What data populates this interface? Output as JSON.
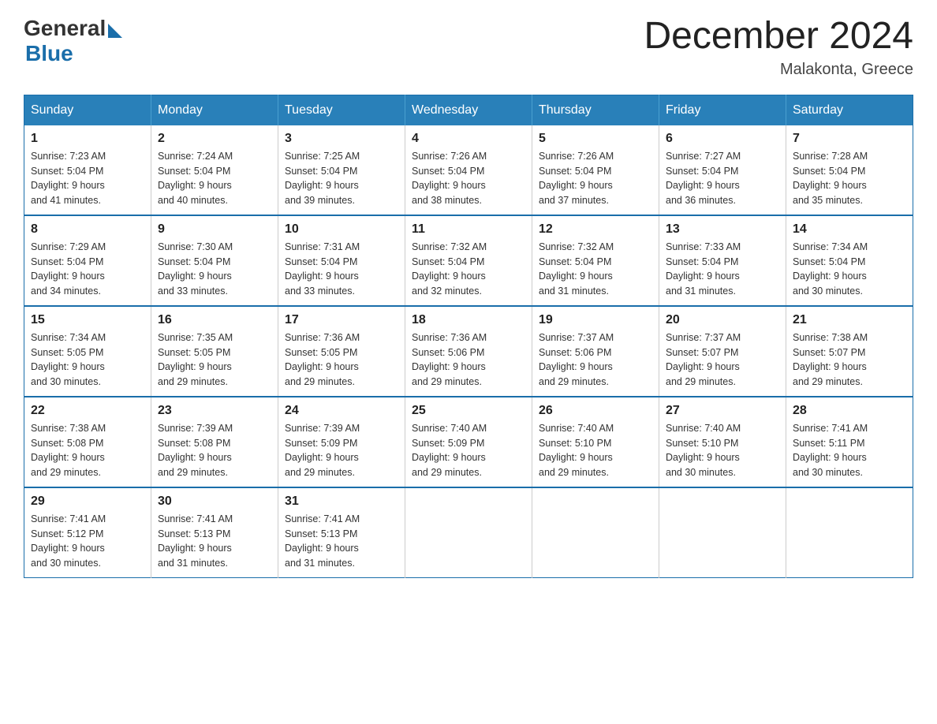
{
  "logo": {
    "general": "General",
    "blue": "Blue"
  },
  "title": {
    "month_year": "December 2024",
    "location": "Malakonta, Greece"
  },
  "days_of_week": [
    "Sunday",
    "Monday",
    "Tuesday",
    "Wednesday",
    "Thursday",
    "Friday",
    "Saturday"
  ],
  "weeks": [
    [
      {
        "day": "1",
        "sunrise": "7:23 AM",
        "sunset": "5:04 PM",
        "daylight": "9 hours and 41 minutes."
      },
      {
        "day": "2",
        "sunrise": "7:24 AM",
        "sunset": "5:04 PM",
        "daylight": "9 hours and 40 minutes."
      },
      {
        "day": "3",
        "sunrise": "7:25 AM",
        "sunset": "5:04 PM",
        "daylight": "9 hours and 39 minutes."
      },
      {
        "day": "4",
        "sunrise": "7:26 AM",
        "sunset": "5:04 PM",
        "daylight": "9 hours and 38 minutes."
      },
      {
        "day": "5",
        "sunrise": "7:26 AM",
        "sunset": "5:04 PM",
        "daylight": "9 hours and 37 minutes."
      },
      {
        "day": "6",
        "sunrise": "7:27 AM",
        "sunset": "5:04 PM",
        "daylight": "9 hours and 36 minutes."
      },
      {
        "day": "7",
        "sunrise": "7:28 AM",
        "sunset": "5:04 PM",
        "daylight": "9 hours and 35 minutes."
      }
    ],
    [
      {
        "day": "8",
        "sunrise": "7:29 AM",
        "sunset": "5:04 PM",
        "daylight": "9 hours and 34 minutes."
      },
      {
        "day": "9",
        "sunrise": "7:30 AM",
        "sunset": "5:04 PM",
        "daylight": "9 hours and 33 minutes."
      },
      {
        "day": "10",
        "sunrise": "7:31 AM",
        "sunset": "5:04 PM",
        "daylight": "9 hours and 33 minutes."
      },
      {
        "day": "11",
        "sunrise": "7:32 AM",
        "sunset": "5:04 PM",
        "daylight": "9 hours and 32 minutes."
      },
      {
        "day": "12",
        "sunrise": "7:32 AM",
        "sunset": "5:04 PM",
        "daylight": "9 hours and 31 minutes."
      },
      {
        "day": "13",
        "sunrise": "7:33 AM",
        "sunset": "5:04 PM",
        "daylight": "9 hours and 31 minutes."
      },
      {
        "day": "14",
        "sunrise": "7:34 AM",
        "sunset": "5:04 PM",
        "daylight": "9 hours and 30 minutes."
      }
    ],
    [
      {
        "day": "15",
        "sunrise": "7:34 AM",
        "sunset": "5:05 PM",
        "daylight": "9 hours and 30 minutes."
      },
      {
        "day": "16",
        "sunrise": "7:35 AM",
        "sunset": "5:05 PM",
        "daylight": "9 hours and 29 minutes."
      },
      {
        "day": "17",
        "sunrise": "7:36 AM",
        "sunset": "5:05 PM",
        "daylight": "9 hours and 29 minutes."
      },
      {
        "day": "18",
        "sunrise": "7:36 AM",
        "sunset": "5:06 PM",
        "daylight": "9 hours and 29 minutes."
      },
      {
        "day": "19",
        "sunrise": "7:37 AM",
        "sunset": "5:06 PM",
        "daylight": "9 hours and 29 minutes."
      },
      {
        "day": "20",
        "sunrise": "7:37 AM",
        "sunset": "5:07 PM",
        "daylight": "9 hours and 29 minutes."
      },
      {
        "day": "21",
        "sunrise": "7:38 AM",
        "sunset": "5:07 PM",
        "daylight": "9 hours and 29 minutes."
      }
    ],
    [
      {
        "day": "22",
        "sunrise": "7:38 AM",
        "sunset": "5:08 PM",
        "daylight": "9 hours and 29 minutes."
      },
      {
        "day": "23",
        "sunrise": "7:39 AM",
        "sunset": "5:08 PM",
        "daylight": "9 hours and 29 minutes."
      },
      {
        "day": "24",
        "sunrise": "7:39 AM",
        "sunset": "5:09 PM",
        "daylight": "9 hours and 29 minutes."
      },
      {
        "day": "25",
        "sunrise": "7:40 AM",
        "sunset": "5:09 PM",
        "daylight": "9 hours and 29 minutes."
      },
      {
        "day": "26",
        "sunrise": "7:40 AM",
        "sunset": "5:10 PM",
        "daylight": "9 hours and 29 minutes."
      },
      {
        "day": "27",
        "sunrise": "7:40 AM",
        "sunset": "5:10 PM",
        "daylight": "9 hours and 30 minutes."
      },
      {
        "day": "28",
        "sunrise": "7:41 AM",
        "sunset": "5:11 PM",
        "daylight": "9 hours and 30 minutes."
      }
    ],
    [
      {
        "day": "29",
        "sunrise": "7:41 AM",
        "sunset": "5:12 PM",
        "daylight": "9 hours and 30 minutes."
      },
      {
        "day": "30",
        "sunrise": "7:41 AM",
        "sunset": "5:13 PM",
        "daylight": "9 hours and 31 minutes."
      },
      {
        "day": "31",
        "sunrise": "7:41 AM",
        "sunset": "5:13 PM",
        "daylight": "9 hours and 31 minutes."
      },
      null,
      null,
      null,
      null
    ]
  ],
  "labels": {
    "sunrise": "Sunrise:",
    "sunset": "Sunset:",
    "daylight": "Daylight:"
  }
}
